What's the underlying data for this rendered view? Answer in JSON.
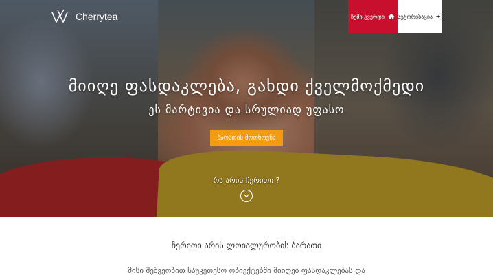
{
  "brand": {
    "name": "Cherrytea",
    "icon": "w-logo-icon"
  },
  "nav": {
    "login_label": "ჩემი გვერდი",
    "login_icon": "home-icon",
    "auth_label": "ავტორიზაცია",
    "auth_icon": "sign-in-icon",
    "login_bg": "#c8102e"
  },
  "hero": {
    "headline": "მიიღე ფასდაკლება, გახდი ქველმოქმედი",
    "subline": "ეს მარტივია და სრულიად უფასო",
    "cta_label": "ბარათის მოთხოვნა",
    "cta_color": "#f39c12",
    "what_label": "რა არის ჩერითი ?",
    "scroll_icon": "chevron-down-circle-icon"
  },
  "section": {
    "title": "ჩერითი არის ლოიალურობის ბარათი",
    "text": "მისი მეშვეობით საუკეთესო ობიექტებში მიიღებ ფასდაკლებას და"
  }
}
